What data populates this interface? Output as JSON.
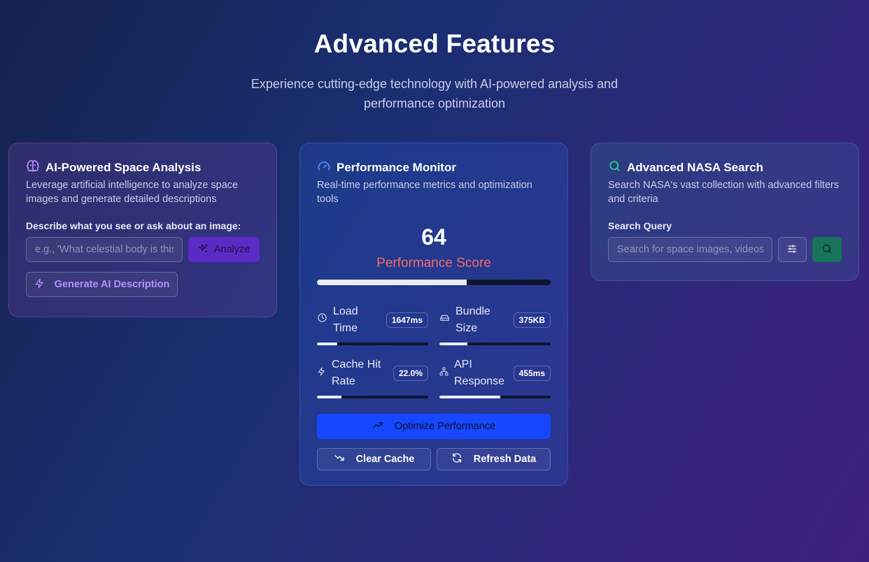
{
  "hero": {
    "title": "Advanced Features",
    "subtitle": "Experience cutting-edge technology with AI-powered analysis and performance optimization"
  },
  "ai_card": {
    "icon": "brain-icon",
    "title": "AI-Powered Space Analysis",
    "description": "Leverage artificial intelligence to analyze space images and generate detailed descriptions",
    "prompt_label": "Describe what you see or ask about an image:",
    "input_placeholder": "e.g., 'What celestial body is this?'",
    "analyze_label": "Analyze",
    "generate_label": "Generate AI Description"
  },
  "perf_card": {
    "icon": "gauge-icon",
    "title": "Performance Monitor",
    "description": "Real-time performance metrics and optimization tools",
    "score": "64",
    "score_fraction": 0.64,
    "score_label": "Performance Score",
    "metrics": [
      {
        "icon": "clock-icon",
        "label": "Load Time",
        "value": "1647ms",
        "fraction": 0.18
      },
      {
        "icon": "hard-drive-icon",
        "label": "Bundle Size",
        "value": "375KB",
        "fraction": 0.25
      },
      {
        "icon": "zap-icon",
        "label": "Cache Hit Rate",
        "value": "22.0%",
        "fraction": 0.22
      },
      {
        "icon": "network-icon",
        "label": "API Response",
        "value": "455ms",
        "fraction": 0.55
      }
    ],
    "optimize_label": "Optimize Performance",
    "clear_cache_label": "Clear Cache",
    "refresh_label": "Refresh Data"
  },
  "search_card": {
    "icon": "search-icon",
    "title": "Advanced NASA Search",
    "description": "Search NASA's vast collection with advanced filters and criteria",
    "query_label": "Search Query",
    "input_placeholder": "Search for space images, videos..."
  },
  "colors": {
    "accent_purple": "#5b2bc6",
    "accent_blue": "#1747ff",
    "accent_green": "#18755a",
    "score_red": "#f26a6a"
  }
}
